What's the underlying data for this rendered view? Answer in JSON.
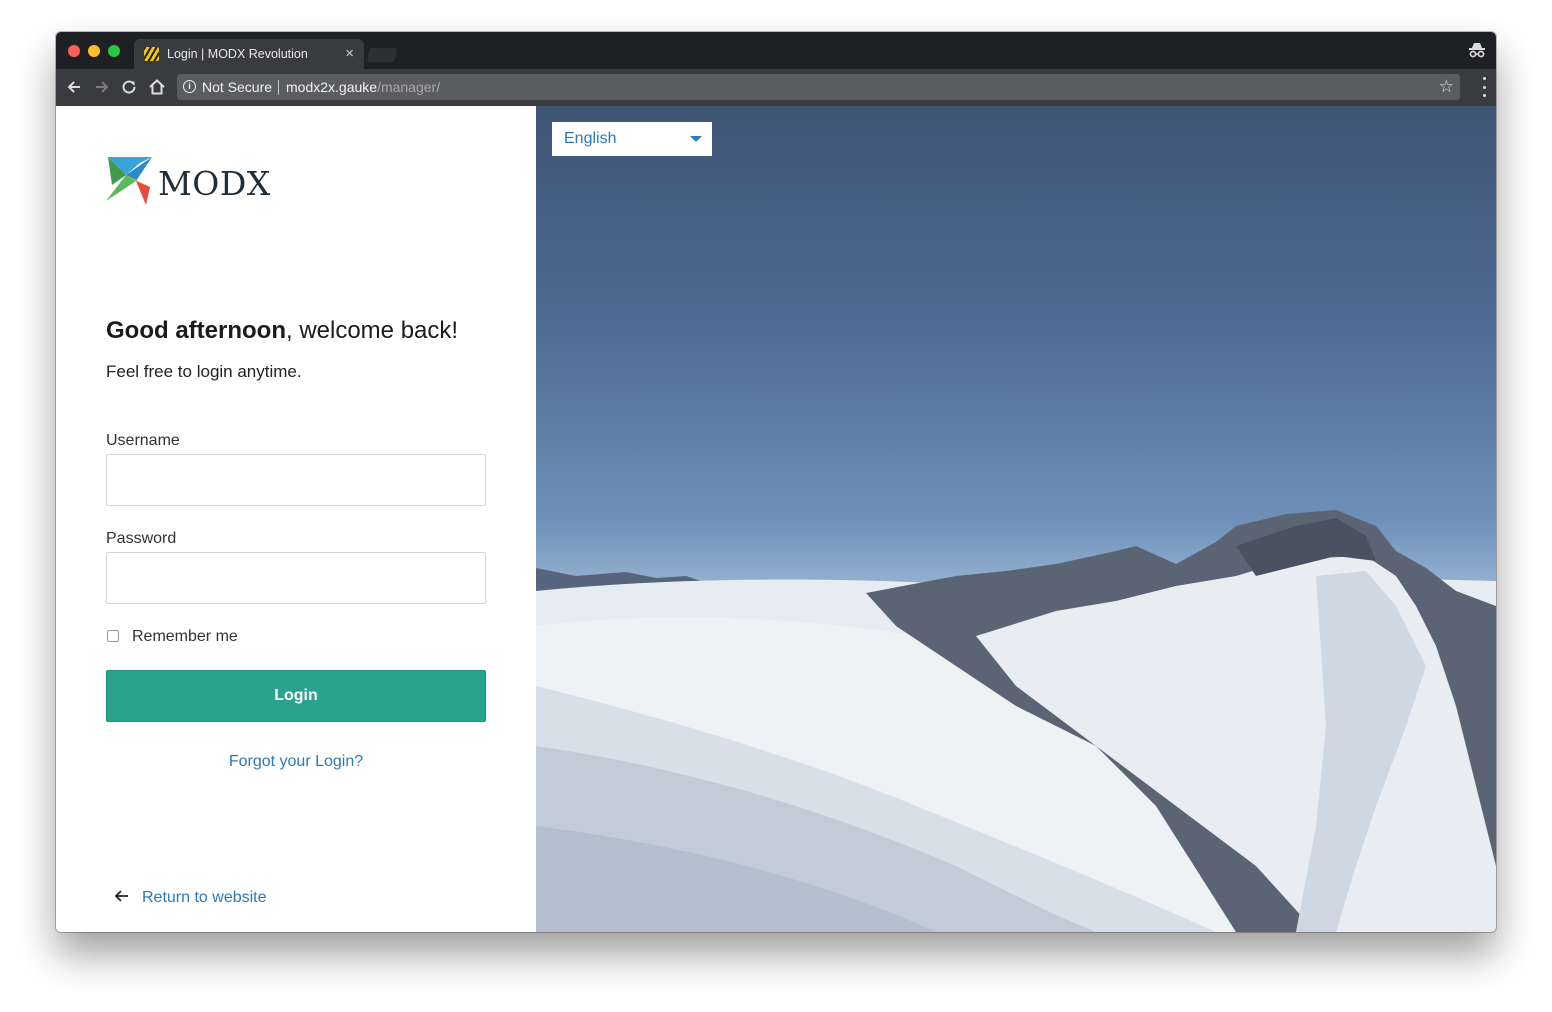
{
  "browser": {
    "tab_title": "Login | MODX Revolution",
    "tab_close": "×",
    "security_label": "Not Secure",
    "url_host": "modx2x.gauke",
    "url_path": "/manager/"
  },
  "brand": {
    "logo_text": "MODX",
    "colors": {
      "primary_button": "#2aa38d",
      "link": "#2c79b8",
      "logo_green": "#5cb85c",
      "logo_blue": "#3aa3d8",
      "logo_red": "#e74c3c",
      "logo_yellow": "#f1c40f"
    }
  },
  "login": {
    "greeting_bold": "Good afternoon",
    "greeting_rest": ", welcome back!",
    "subtext": "Feel free to login anytime.",
    "username_label": "Username",
    "username_value": "",
    "password_label": "Password",
    "password_value": "",
    "remember_label": "Remember me",
    "remember_checked": false,
    "login_button": "Login",
    "forgot_link": "Forgot your Login?",
    "return_link": "Return to website"
  },
  "language": {
    "selected": "English"
  },
  "icons": {
    "back": "arrow-left-icon",
    "forward": "arrow-right-icon",
    "reload": "reload-icon",
    "home": "home-icon",
    "info": "info-icon",
    "bookmark": "star-icon",
    "menu": "kebab-menu-icon",
    "incognito": "incognito-icon",
    "return": "arrow-left-icon",
    "dropdown": "caret-down-icon"
  }
}
